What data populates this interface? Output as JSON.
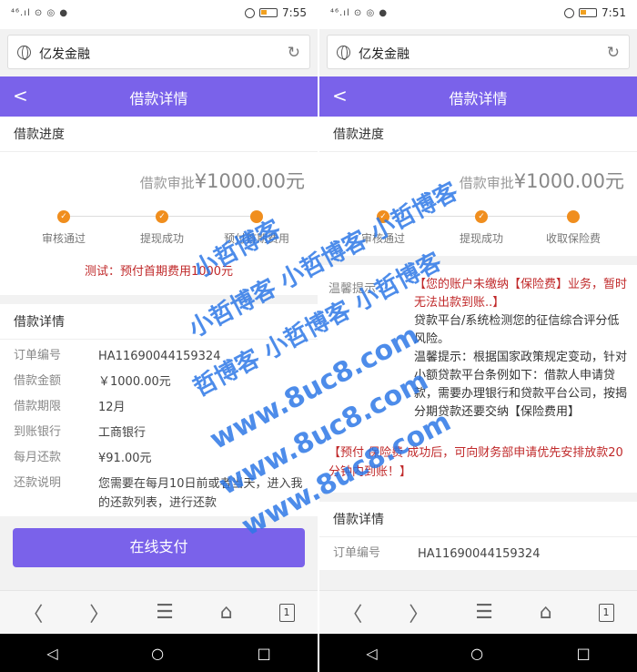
{
  "left": {
    "status": {
      "signal": "⁴⁶.ıl ⊙ ◎ ●",
      "time": "7:55"
    },
    "url_title": "亿发金融",
    "app_title": "借款详情",
    "progress": {
      "title": "借款进度",
      "amount_label": "借款审批",
      "amount_value": "¥1000.00元",
      "steps": [
        "审核通过",
        "提现成功",
        "预付首期费用"
      ],
      "note": "测试：预付首期费用1000元"
    },
    "details": {
      "title": "借款详情",
      "rows": [
        {
          "k": "订单编号",
          "v": "HA11690044159324"
        },
        {
          "k": "借款金额",
          "v": "￥1000.00元"
        },
        {
          "k": "借款期限",
          "v": "12月"
        },
        {
          "k": "到账银行",
          "v": "工商银行"
        },
        {
          "k": "每月还款",
          "v": "¥91.00元"
        },
        {
          "k": "还款说明",
          "v": "您需要在每月10日前或者当天，进入我的还款列表，进行还款"
        }
      ]
    },
    "pay_button": "在线支付"
  },
  "right": {
    "status": {
      "signal": "⁴⁶.ıl ⊙ ◎ ●",
      "time": "7:51"
    },
    "url_title": "亿发金融",
    "app_title": "借款详情",
    "progress": {
      "title": "借款进度",
      "amount_label": "借款审批",
      "amount_value": "¥1000.00元",
      "steps": [
        "审核通过",
        "提现成功",
        "收取保险费"
      ]
    },
    "tip": {
      "label": "温馨提示",
      "red": "【您的账户未缴纳【保险费】业务，暂时无法出款到账..】",
      "body1": "贷款平台/系统检测您的征信综合评分低风险。",
      "body2": "温馨提示：根据国家政策规定变动，针对小额贷款平台条例如下：借款人申请贷款，需要办理银行和贷款平台公司，按揭分期贷款还要交纳【保险费用】"
    },
    "announcement": "【预付 保险费 成功后，可向财务部申请优先安排放款20分钟内到账！】",
    "details": {
      "title": "借款详情",
      "rows": [
        {
          "k": "订单编号",
          "v": "HA11690044159324"
        }
      ]
    }
  },
  "navbar": {
    "back": "〈",
    "forward": "〉",
    "menu": "☰",
    "home": "⌂",
    "tabs_count": "1"
  },
  "sysnav": {
    "back": "◁",
    "home": "○",
    "recent": "□"
  },
  "watermark": [
    "小哲博客",
    "小哲博客 小哲博客 小哲博客",
    "哲博客 小哲博客 小哲博客",
    "www.8uc8.com",
    "www.8uc8.com",
    "www.8uc8.com"
  ],
  "colors": {
    "accent": "#7a62ea",
    "step": "#f08e1e",
    "warn": "#c0292a",
    "watermark": "#2e78e6"
  }
}
